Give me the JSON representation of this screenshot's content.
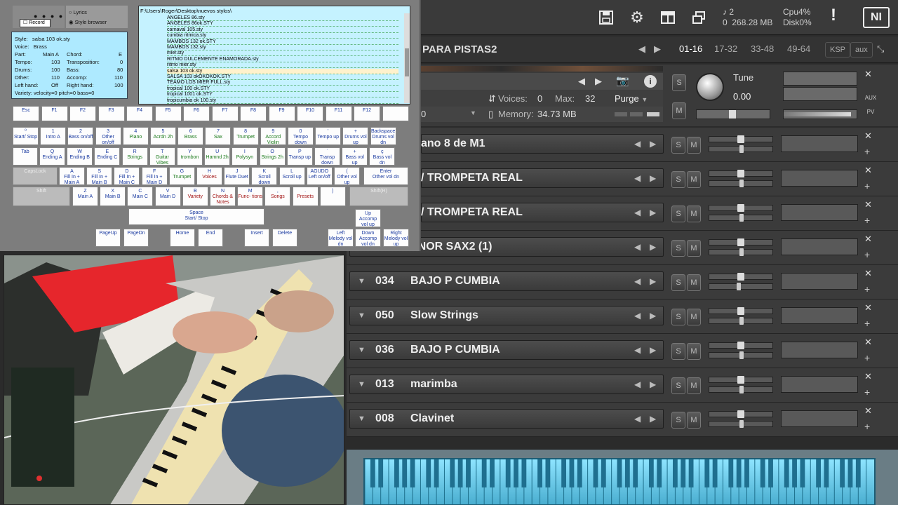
{
  "style_browser": {
    "record_label": "Record",
    "radio_lyrics": "Lyrics",
    "radio_style_browser": "Style browser",
    "info": {
      "style": "salsa 103 ok.sty",
      "voice": "Brass",
      "part": "Main A",
      "chord": "E",
      "tempo": "103",
      "transposition": "0",
      "drums": "100",
      "bass": "80",
      "other": "110",
      "accomp": "110",
      "left_hand": "Off",
      "right_hand": "100",
      "variety": "velocity=0 pitch=0 bass=0",
      "labels": {
        "style": "Style:",
        "voice": "Voice:",
        "part": "Part:",
        "chord": "Chord:",
        "tempo": "Tempo:",
        "transposition": "Transposition:",
        "drums": "Drums:",
        "bass": "Bass:",
        "other": "Other:",
        "accomp": "Accomp:",
        "left_hand": "Left hand:",
        "right_hand": "Right hand:",
        "variety": "Variety:"
      }
    },
    "path": "F:\\Users\\Roger\\Desktop\\nuevos stylos\\",
    "styles": [
      "ANGELES 86.sty",
      "ANGELES 86ok.STY",
      "carnaval 105.sty",
      "cumbia ritmica.sty",
      "MAMBOS 132 ok.STY",
      "MAMBOS 132.sty",
      "mier.sty",
      "RITMO DULCEMENTE ENAMORADA.sty",
      "ritmo mier.sty",
      "salsa 103 ok.sty",
      "SALSA 103 okOKOKOK.STY",
      "TEAMO LOS MIER FULL.sty",
      "tropical 100 ok.STY",
      "tropical 1001 ok.STY",
      "tropicumbia ok 100.sty"
    ],
    "selected_style": 9,
    "function_keys": [
      "Esc",
      "F1",
      "F2",
      "F3",
      "F4",
      "F5",
      "F6",
      "F7",
      "F8",
      "F9",
      "F10",
      "F11",
      "F12",
      ""
    ],
    "row1": [
      {
        "top": "º",
        "bottom": "Start/ Stop"
      },
      {
        "top": "1",
        "bottom": "Intro A"
      },
      {
        "top": "2",
        "bottom": "Bass on/off"
      },
      {
        "top": "3",
        "bottom": "Other on/off"
      },
      {
        "top": "4",
        "bottom": "Piano",
        "c": "g"
      },
      {
        "top": "5",
        "bottom": "Acrdn 2h",
        "c": "g"
      },
      {
        "top": "6",
        "bottom": "Brass",
        "c": "g"
      },
      {
        "top": "7",
        "bottom": "Sax",
        "c": "g"
      },
      {
        "top": "8",
        "bottom": "Trumpet",
        "c": "g"
      },
      {
        "top": "9",
        "bottom": "Accord Violin",
        "c": "g"
      },
      {
        "top": "0",
        "bottom": "Tempo down"
      },
      {
        "top": "'",
        "bottom": "Tempo up"
      },
      {
        "top": "+",
        "bottom": "Drums vol up"
      },
      {
        "top": "Backspace",
        "bottom": "Drums vol dn"
      }
    ],
    "row2": [
      {
        "top": "Tab",
        "bottom": ""
      },
      {
        "top": "Q",
        "bottom": "Ending A"
      },
      {
        "top": "W",
        "bottom": "Ending B"
      },
      {
        "top": "E",
        "bottom": "Ending C"
      },
      {
        "top": "R",
        "bottom": "Strings",
        "c": "g"
      },
      {
        "top": "T",
        "bottom": "Guitar Vibes",
        "c": "g"
      },
      {
        "top": "Y",
        "bottom": "trombon",
        "c": "g"
      },
      {
        "top": "U",
        "bottom": "Hamnd 2h",
        "c": "g"
      },
      {
        "top": "I",
        "bottom": "Polysyn",
        "c": "g"
      },
      {
        "top": "O",
        "bottom": "Strings 2h",
        "c": "g"
      },
      {
        "top": "P",
        "bottom": "Transp up"
      },
      {
        "top": "`",
        "bottom": "Transp down"
      },
      {
        "top": "+",
        "bottom": "Bass vol up"
      },
      {
        "top": "ç",
        "bottom": "Bass vol dn"
      }
    ],
    "row3": [
      {
        "top": "CapsLock",
        "bottom": "",
        "grey": true
      },
      {
        "top": "A",
        "bottom": "Fill In + Main A"
      },
      {
        "top": "S",
        "bottom": "Fill In + Main B"
      },
      {
        "top": "D",
        "bottom": "Fill In + Main C"
      },
      {
        "top": "F",
        "bottom": "Fill In + Main D"
      },
      {
        "top": "G",
        "bottom": "Trumpet",
        "c": "g"
      },
      {
        "top": "H",
        "bottom": "Voices",
        "c": "r"
      },
      {
        "top": "J",
        "bottom": "Flute Duet"
      },
      {
        "top": "K",
        "bottom": "Scroll down"
      },
      {
        "top": "L",
        "bottom": "Scroll up"
      },
      {
        "top": "AGUDO",
        "bottom": "Left on/off"
      },
      {
        "top": "(",
        "bottom": "Other vol up"
      },
      {
        "top": "Enter",
        "bottom": "Other vol dn"
      }
    ],
    "row4": [
      {
        "top": "Shift",
        "bottom": "",
        "grey": true
      },
      {
        "top": "Z",
        "bottom": "Main A"
      },
      {
        "top": "X",
        "bottom": "Main B"
      },
      {
        "top": "C",
        "bottom": "Main C"
      },
      {
        "top": "V",
        "bottom": "Main D"
      },
      {
        "top": "B",
        "bottom": "Variety",
        "c": "r"
      },
      {
        "top": "N",
        "bottom": "Chords & Notes",
        "c": "r"
      },
      {
        "top": "M",
        "bottom": "Func- tions",
        "c": "r"
      },
      {
        "top": ",",
        "bottom": "Songs",
        "c": "r"
      },
      {
        "top": ".",
        "bottom": "Presets",
        "c": "r"
      },
      {
        "top": ")",
        "bottom": ""
      },
      {
        "top": "Shift(R)",
        "bottom": "",
        "grey": true
      }
    ],
    "space": {
      "top": "Space",
      "bottom": "Start/ Stop"
    },
    "nav_keys": [
      {
        "top": "PageUp",
        "bottom": ""
      },
      {
        "top": "PageDn",
        "bottom": ""
      },
      {
        "top": "Home",
        "bottom": ""
      },
      {
        "top": "End",
        "bottom": ""
      },
      {
        "top": "Insert",
        "bottom": ""
      },
      {
        "top": "Delete",
        "bottom": ""
      }
    ],
    "arrow_keys": [
      {
        "top": "Up",
        "bottom": "Accomp vol up"
      },
      {
        "top": "Left",
        "bottom": "Melody vol dn"
      },
      {
        "top": "Down",
        "bottom": "Accomp vol dn"
      },
      {
        "top": "Right",
        "bottom": "Melody vol up"
      }
    ]
  },
  "kontakt": {
    "toolbar_icons": [
      "save-icon",
      "gear-icon",
      "layout-icon",
      "window-icon"
    ],
    "instances": "2",
    "memory_total": "268.28 MB",
    "zero": "0",
    "cpu_label": "Cpu",
    "cpu": "4%",
    "disk_label": "Disk",
    "disk": "0%",
    "warn": "!",
    "ni_logo": "NI",
    "rack_title": "PARA PISTAS2",
    "page_tabs": [
      "01-16",
      "17-32",
      "33-48",
      "49-64"
    ],
    "active_tab": 0,
    "ksp": "KSP",
    "aux": "aux",
    "voices_label": "Voices:",
    "voices": "0",
    "max_label": "Max:",
    "max": "32",
    "purge": "Purge",
    "memory_label": "Memory:",
    "memory": "34.73 MB",
    "channel_zero": "0",
    "tune_label": "Tune",
    "tune_value": "0.00",
    "aux_label": "AUX",
    "pv_label": "PV",
    "s": "S",
    "m": "M",
    "accent": "#3a3a3a",
    "instruments": [
      {
        "num": "",
        "name": "ano 8 de M1"
      },
      {
        "num": "",
        "name": "/ TROMPETA REAL"
      },
      {
        "num": "",
        "name": "/ TROMPETA REAL"
      },
      {
        "num": "",
        "name": "ENOR SAX2 (1)"
      },
      {
        "num": "034",
        "name": "BAJO P CUMBIA"
      },
      {
        "num": "050",
        "name": "Slow Strings"
      },
      {
        "num": "036",
        "name": "BAJO P CUMBIA"
      },
      {
        "num": "013",
        "name": "marimba"
      },
      {
        "num": "008",
        "name": "Clavinet"
      }
    ],
    "pan_levels": [
      0.5,
      0.5,
      0.5,
      0.5,
      0.45,
      0.5,
      0.5,
      0.5,
      0.5
    ]
  }
}
